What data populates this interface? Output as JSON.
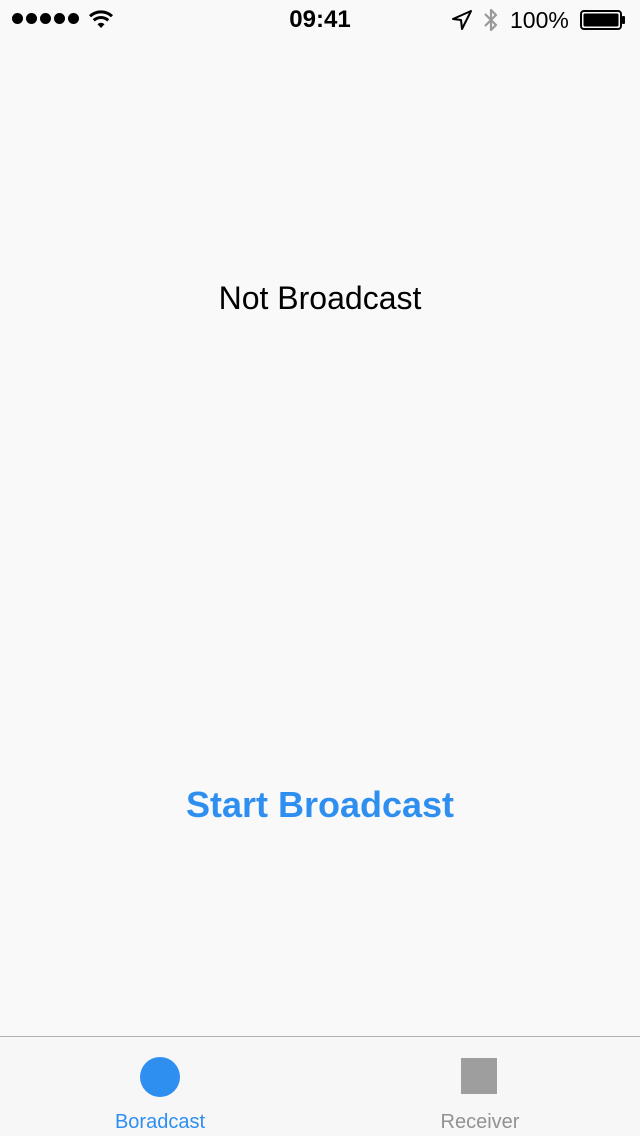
{
  "status_bar": {
    "time": "09:41",
    "battery_percent": "100%",
    "signal_bars": 5,
    "icons": [
      "signal-dots-icon",
      "wifi-icon",
      "location-arrow-icon",
      "bluetooth-icon",
      "battery-icon"
    ]
  },
  "main": {
    "status_text": "Not Broadcast",
    "action_button_label": "Start Broadcast"
  },
  "tab_bar": {
    "tabs": [
      {
        "label": "Boradcast",
        "icon": "circle-icon",
        "selected": true
      },
      {
        "label": "Receiver",
        "icon": "square-icon",
        "selected": false
      }
    ]
  },
  "colors": {
    "accent": "#2f8ff0",
    "inactive": "#929292",
    "inactive_icon": "#9e9e9e",
    "background": "#f9f9f9"
  }
}
